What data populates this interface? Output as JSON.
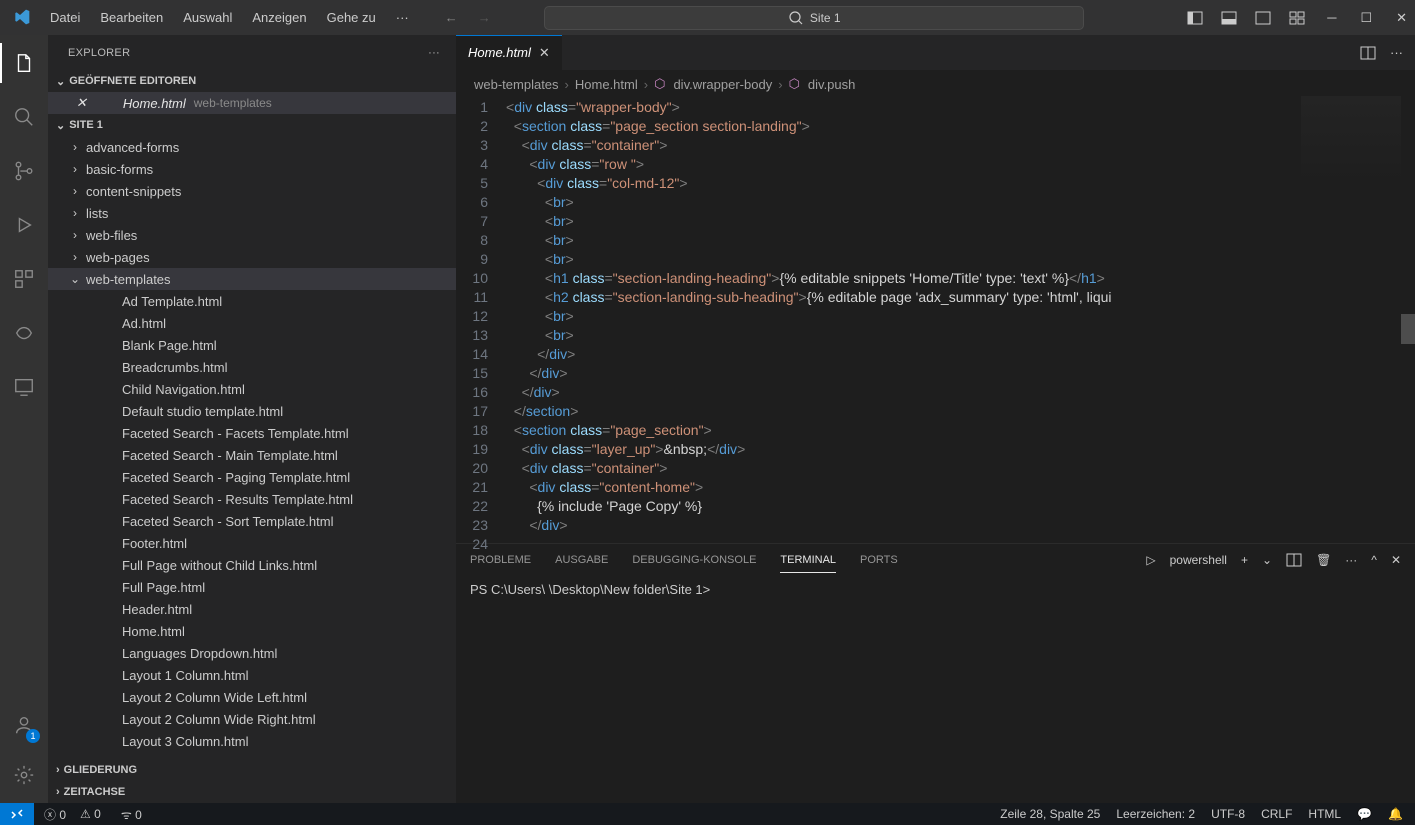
{
  "titlebar": {
    "menu": [
      "Datei",
      "Bearbeiten",
      "Auswahl",
      "Anzeigen",
      "Gehe zu"
    ],
    "search_label": "Site 1"
  },
  "sidebar": {
    "title": "EXPLORER",
    "open_editors_label": "GEÖFFNETE EDITOREN",
    "open_file": {
      "name": "Home.html",
      "path": "web-templates"
    },
    "workspace": "SITE 1",
    "folders": [
      {
        "name": "advanced-forms",
        "expanded": false
      },
      {
        "name": "basic-forms",
        "expanded": false
      },
      {
        "name": "content-snippets",
        "expanded": false
      },
      {
        "name": "lists",
        "expanded": false
      },
      {
        "name": "web-files",
        "expanded": false
      },
      {
        "name": "web-pages",
        "expanded": false
      },
      {
        "name": "web-templates",
        "expanded": true
      }
    ],
    "files": [
      "Ad Template.html",
      "Ad.html",
      "Blank Page.html",
      "Breadcrumbs.html",
      "Child Navigation.html",
      "Default studio template.html",
      "Faceted Search - Facets Template.html",
      "Faceted Search - Main Template.html",
      "Faceted Search - Paging Template.html",
      "Faceted Search - Results Template.html",
      "Faceted Search - Sort Template.html",
      "Footer.html",
      "Full Page without Child Links.html",
      "Full Page.html",
      "Header.html",
      "Home.html",
      "Languages Dropdown.html",
      "Layout 1 Column.html",
      "Layout 2 Column Wide Left.html",
      "Layout 2 Column Wide Right.html",
      "Layout 3 Column.html"
    ],
    "outline_label": "GLIEDERUNG",
    "timeline_label": "ZEITACHSE"
  },
  "tab": {
    "name": "Home.html"
  },
  "breadcrumbs": [
    "web-templates",
    "Home.html",
    "div.wrapper-body",
    "div.push"
  ],
  "code": {
    "lines": [
      1,
      2,
      3,
      4,
      5,
      6,
      7,
      8,
      9,
      10,
      11,
      12,
      13,
      14,
      15,
      16,
      17,
      18,
      19,
      20,
      21,
      22,
      23,
      24
    ]
  },
  "panel": {
    "tabs": [
      "PROBLEME",
      "AUSGABE",
      "DEBUGGING-KONSOLE",
      "TERMINAL",
      "PORTS"
    ],
    "active_tab": "TERMINAL",
    "shell_label": "powershell",
    "prompt": "PS C:\\Users\\        \\Desktop\\New folder\\Site 1>"
  },
  "statusbar": {
    "errors": "0",
    "warnings": "0",
    "ports": "0",
    "position": "Zeile 28, Spalte 25",
    "spaces": "Leerzeichen: 2",
    "encoding": "UTF-8",
    "eol": "CRLF",
    "lang": "HTML"
  },
  "accounts_badge": "1"
}
